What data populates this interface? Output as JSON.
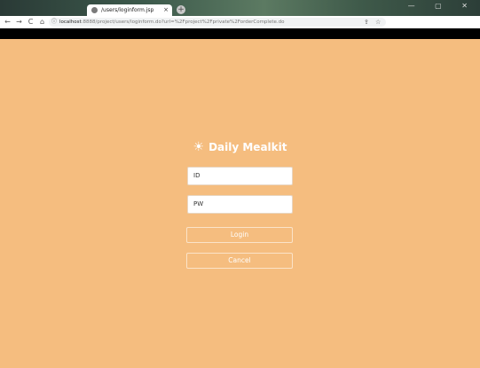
{
  "browser": {
    "tab_title": "/users/loginform.jsp",
    "tab_close": "×",
    "new_tab": "+",
    "window_controls": "— ▢ ✕",
    "nav": {
      "back": "←",
      "forward": "→",
      "reload": "C",
      "home": "⌂"
    },
    "address_info": "ⓘ",
    "url_host": "localhost",
    "url_rest": ":8888/project/users/loginform.do?url=%2Fproject%2Fprivate%2ForderComplete.do",
    "share_icon": "⇪",
    "bookmark_icon": "☆"
  },
  "login": {
    "brand_icon": "☀",
    "brand_title": "Daily Mealkit",
    "id_placeholder": "ID",
    "pw_placeholder": "PW",
    "login_label": "Login",
    "cancel_label": "Cancel"
  },
  "colors": {
    "page_background": "#f5bd7f",
    "text": "#ffffff"
  }
}
